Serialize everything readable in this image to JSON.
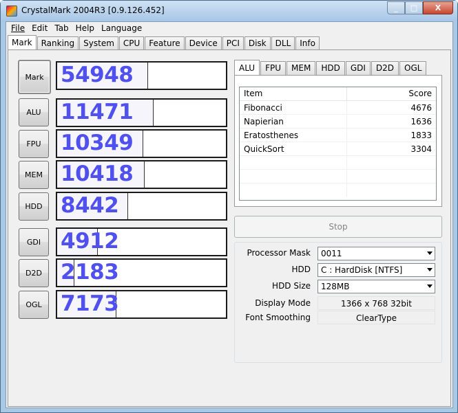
{
  "window": {
    "title": "CrystalMark 2004R3 [0.9.126.452]",
    "minimize": "_",
    "maximize": "□",
    "close": "X"
  },
  "menu": {
    "file": "File",
    "edit": "Edit",
    "tab": "Tab",
    "help": "Help",
    "language": "Language"
  },
  "tabs": [
    "Mark",
    "Ranking",
    "System",
    "CPU",
    "Feature",
    "Device",
    "PCI",
    "Disk",
    "DLL",
    "Info"
  ],
  "active_tab": "Mark",
  "scores": [
    {
      "label": "Mark",
      "value": "54948",
      "fill": 0.54
    },
    {
      "label": "ALU",
      "value": "11471",
      "fill": 0.57
    },
    {
      "label": "FPU",
      "value": "10349",
      "fill": 0.51
    },
    {
      "label": "MEM",
      "value": "10418",
      "fill": 0.52
    },
    {
      "label": "HDD",
      "value": "8442",
      "fill": 0.42
    },
    {
      "label": "GDI",
      "value": "4912",
      "fill": 0.24
    },
    {
      "label": "D2D",
      "value": "2183",
      "fill": 0.1
    },
    {
      "label": "OGL",
      "value": "7173",
      "fill": 0.35
    }
  ],
  "subtabs": [
    "ALU",
    "FPU",
    "MEM",
    "HDD",
    "GDI",
    "D2D",
    "OGL"
  ],
  "active_subtab": "ALU",
  "table": {
    "col_item": "Item",
    "col_score": "Score",
    "rows": [
      {
        "item": "Fibonacci",
        "score": "4676"
      },
      {
        "item": "Napierian",
        "score": "1636"
      },
      {
        "item": "Eratosthenes",
        "score": "1833"
      },
      {
        "item": "QuickSort",
        "score": "3304"
      }
    ]
  },
  "stop_label": "Stop",
  "settings": {
    "processor_mask_label": "Processor Mask",
    "processor_mask_value": "0011",
    "hdd_label": "HDD",
    "hdd_value": "C : HardDisk [NTFS]",
    "hdd_size_label": "HDD Size",
    "hdd_size_value": "128MB",
    "display_mode_label": "Display Mode",
    "display_mode_value": "1366 x 768 32bit",
    "font_smoothing_label": "Font Smoothing",
    "font_smoothing_value": "ClearType"
  },
  "colors": {
    "score_text": "#5050ee",
    "titlebar": "#a9c8e4",
    "close_button": "#c7472f"
  }
}
